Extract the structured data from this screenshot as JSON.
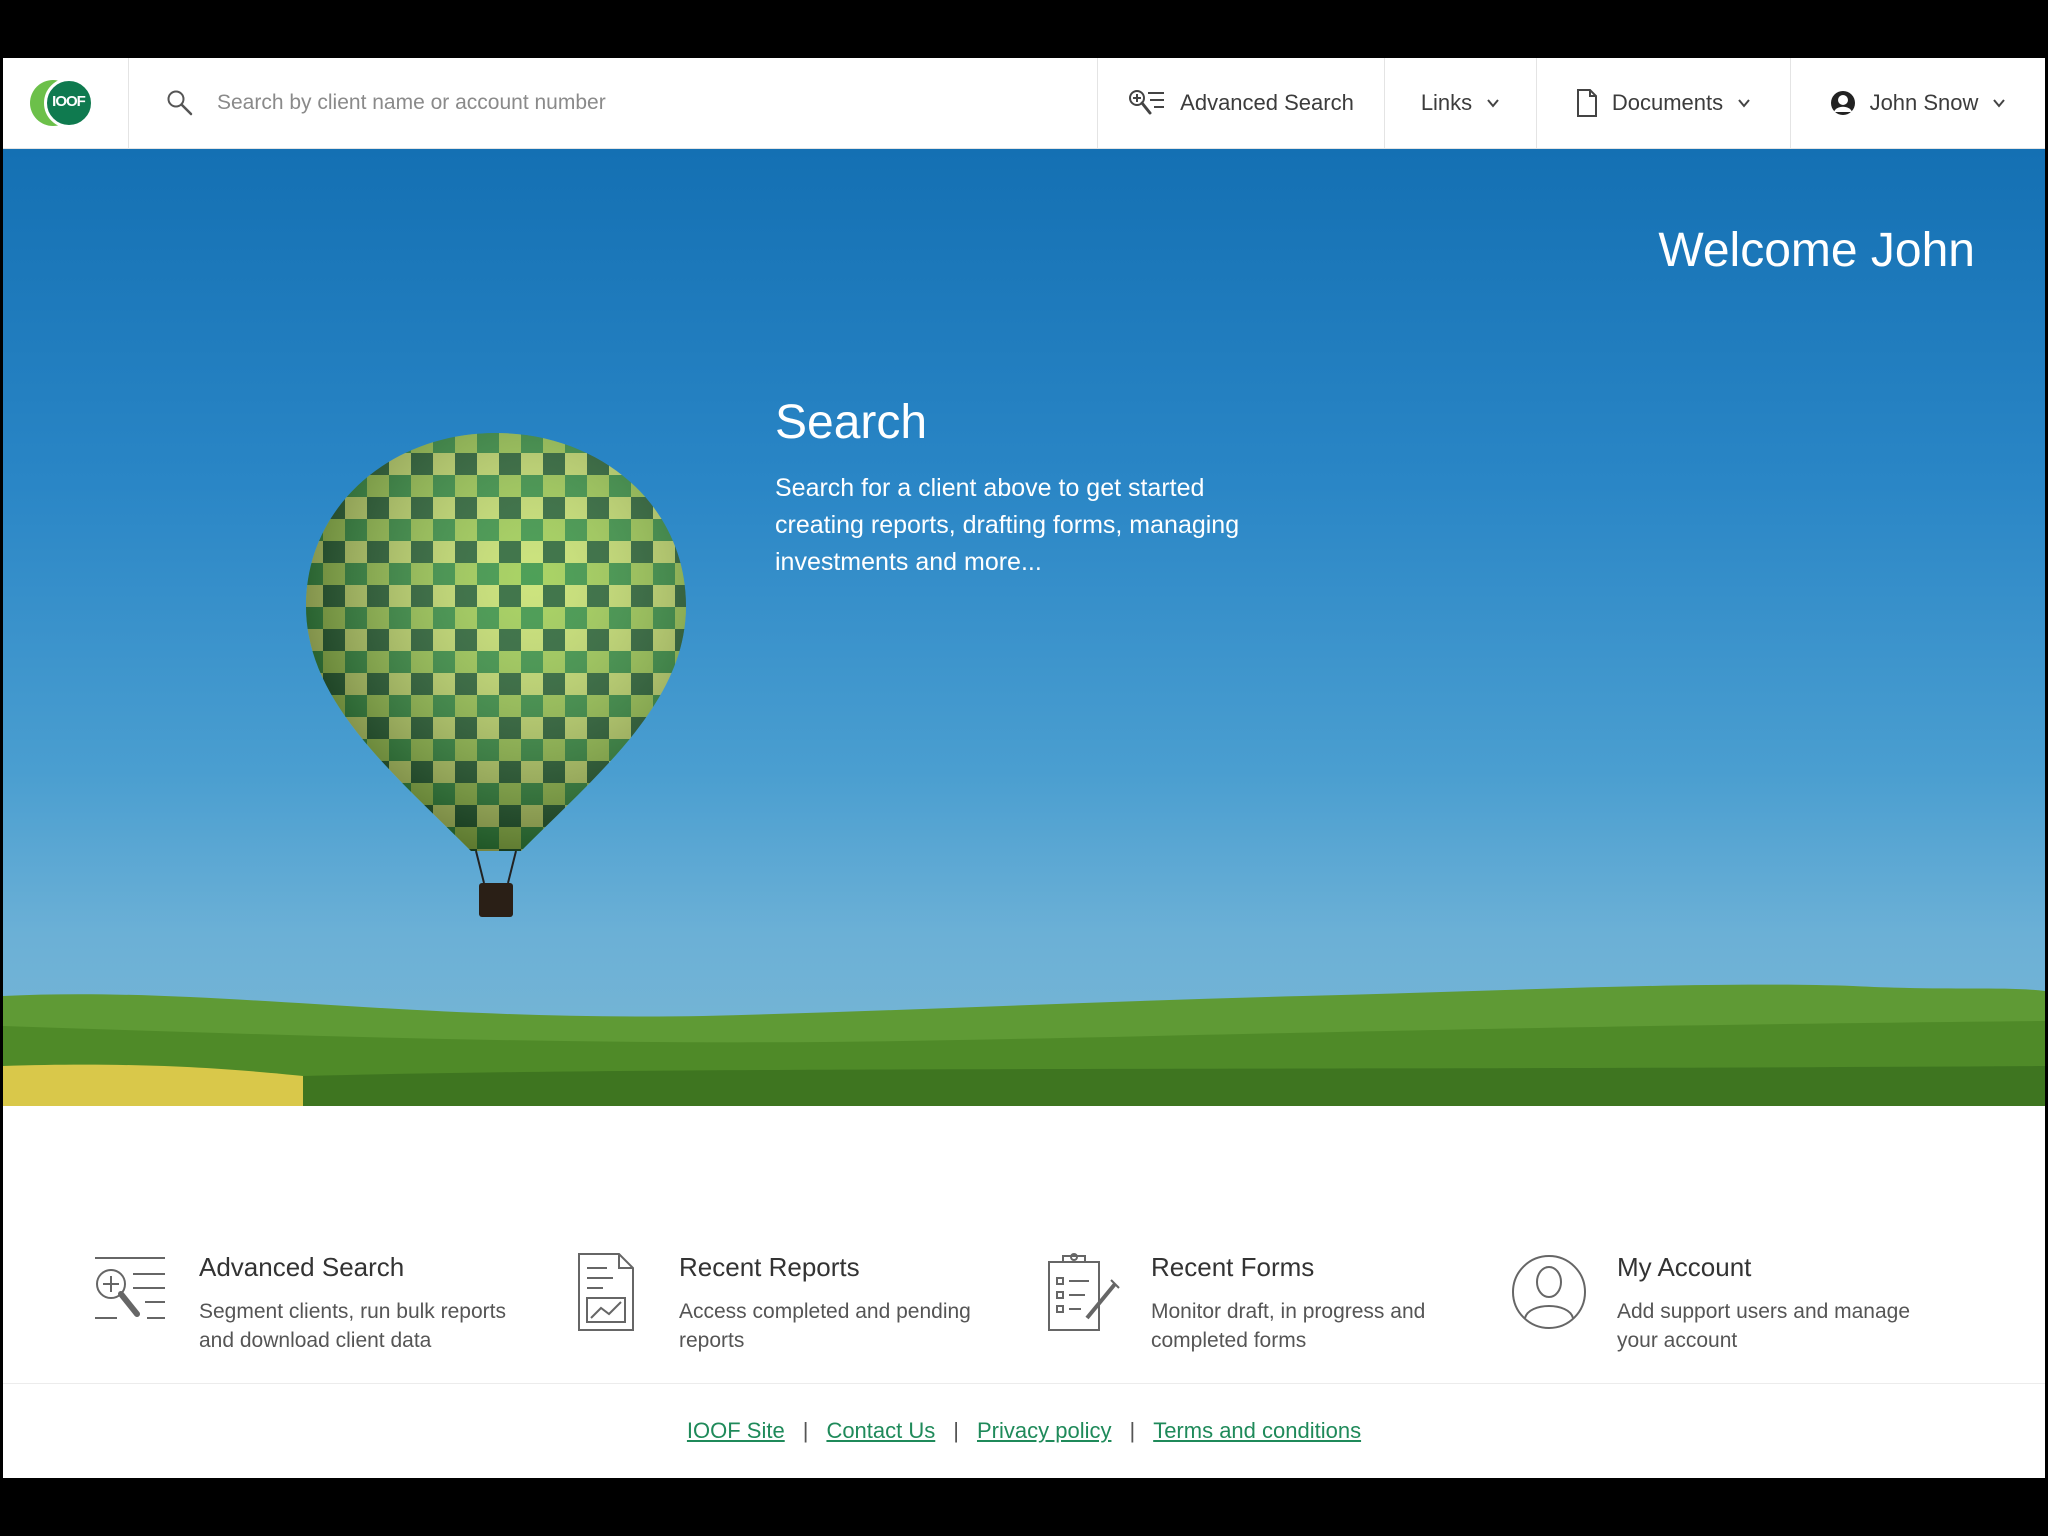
{
  "header": {
    "logo_text": "IOOF",
    "search_placeholder": "Search by client name or account number",
    "advanced_search_label": "Advanced Search",
    "links_label": "Links",
    "documents_label": "Documents",
    "user_name": "John Snow"
  },
  "hero": {
    "welcome": "Welcome John",
    "title": "Search",
    "description": "Search for a client above to get started creating reports, drafting forms, managing investments and more..."
  },
  "features": [
    {
      "title": "Advanced Search",
      "description": "Segment clients, run bulk reports and download client data",
      "icon": "advanced-search-icon"
    },
    {
      "title": "Recent Reports",
      "description": "Access completed and pending reports",
      "icon": "report-chart-icon"
    },
    {
      "title": "Recent Forms",
      "description": "Monitor draft, in progress and completed forms",
      "icon": "clipboard-form-icon"
    },
    {
      "title": "My Account",
      "description": "Add support users and manage your account",
      "icon": "user-account-icon"
    }
  ],
  "footer": {
    "links": [
      "IOOF Site",
      "Contact Us",
      "Privacy policy",
      "Terms and conditions"
    ],
    "separator": "|"
  },
  "colors": {
    "brand_green": "#0f7a4f",
    "brand_light_green": "#6cc04a",
    "link_green": "#1f8a5a",
    "sky_top": "#1470b3",
    "sky_bottom": "#7cb8d4"
  }
}
